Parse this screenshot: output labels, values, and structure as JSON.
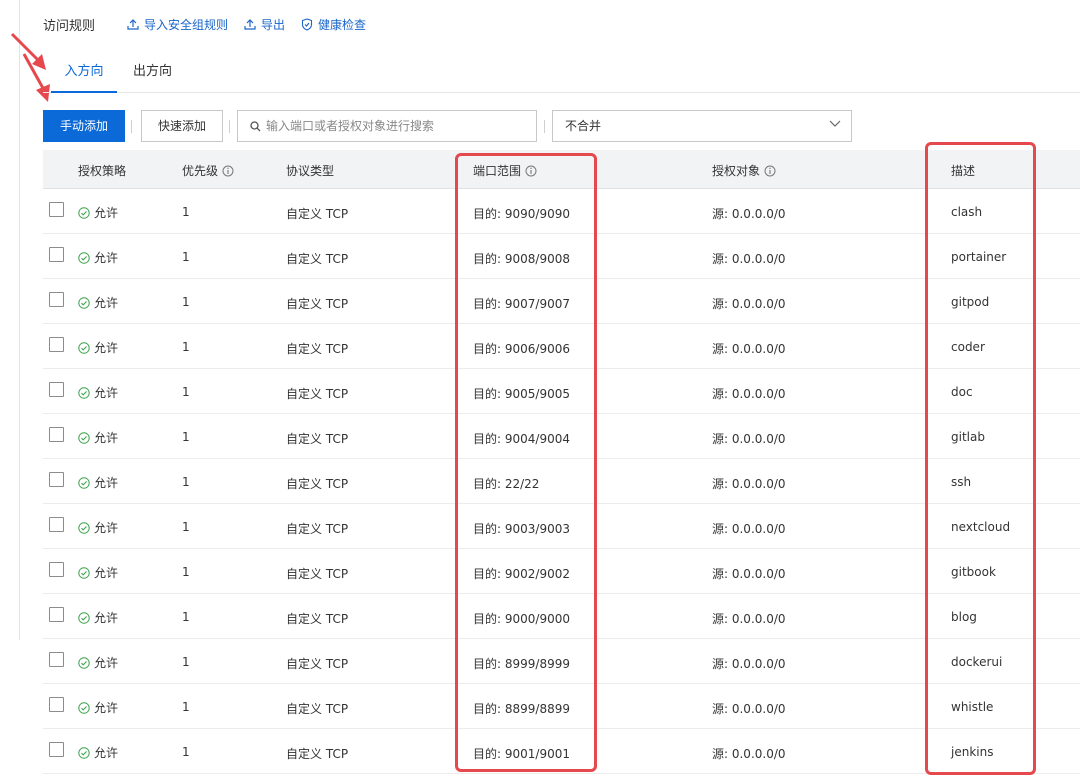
{
  "header": {
    "title": "访问规则",
    "import_label": "导入安全组规则",
    "export_label": "导出",
    "health_label": "健康检查"
  },
  "tabs": {
    "inbound": "入方向",
    "outbound": "出方向"
  },
  "toolbar": {
    "manual_add": "手动添加",
    "quick_add": "快速添加",
    "search_placeholder": "输入端口或者授权对象进行搜索",
    "merge_select": "不合并"
  },
  "table": {
    "headers": {
      "policy": "授权策略",
      "priority": "优先级",
      "protocol": "协议类型",
      "port_range": "端口范围",
      "auth_object": "授权对象",
      "description": "描述"
    },
    "rows": [
      {
        "policy": "允许",
        "priority": "1",
        "protocol": "自定义 TCP",
        "port": "目的: 9090/9090",
        "object": "源: 0.0.0.0/0",
        "desc": "clash"
      },
      {
        "policy": "允许",
        "priority": "1",
        "protocol": "自定义 TCP",
        "port": "目的: 9008/9008",
        "object": "源: 0.0.0.0/0",
        "desc": "portainer"
      },
      {
        "policy": "允许",
        "priority": "1",
        "protocol": "自定义 TCP",
        "port": "目的: 9007/9007",
        "object": "源: 0.0.0.0/0",
        "desc": "gitpod"
      },
      {
        "policy": "允许",
        "priority": "1",
        "protocol": "自定义 TCP",
        "port": "目的: 9006/9006",
        "object": "源: 0.0.0.0/0",
        "desc": "coder"
      },
      {
        "policy": "允许",
        "priority": "1",
        "protocol": "自定义 TCP",
        "port": "目的: 9005/9005",
        "object": "源: 0.0.0.0/0",
        "desc": "doc"
      },
      {
        "policy": "允许",
        "priority": "1",
        "protocol": "自定义 TCP",
        "port": "目的: 9004/9004",
        "object": "源: 0.0.0.0/0",
        "desc": "gitlab"
      },
      {
        "policy": "允许",
        "priority": "1",
        "protocol": "自定义 TCP",
        "port": "目的: 22/22",
        "object": "源: 0.0.0.0/0",
        "desc": "ssh"
      },
      {
        "policy": "允许",
        "priority": "1",
        "protocol": "自定义 TCP",
        "port": "目的: 9003/9003",
        "object": "源: 0.0.0.0/0",
        "desc": "nextcloud"
      },
      {
        "policy": "允许",
        "priority": "1",
        "protocol": "自定义 TCP",
        "port": "目的: 9002/9002",
        "object": "源: 0.0.0.0/0",
        "desc": "gitbook"
      },
      {
        "policy": "允许",
        "priority": "1",
        "protocol": "自定义 TCP",
        "port": "目的: 9000/9000",
        "object": "源: 0.0.0.0/0",
        "desc": "blog"
      },
      {
        "policy": "允许",
        "priority": "1",
        "protocol": "自定义 TCP",
        "port": "目的: 8999/8999",
        "object": "源: 0.0.0.0/0",
        "desc": "dockerui"
      },
      {
        "policy": "允许",
        "priority": "1",
        "protocol": "自定义 TCP",
        "port": "目的: 8899/8899",
        "object": "源: 0.0.0.0/0",
        "desc": "whistle"
      },
      {
        "policy": "允许",
        "priority": "1",
        "protocol": "自定义 TCP",
        "port": "目的: 9001/9001",
        "object": "源: 0.0.0.0/0",
        "desc": "jenkins"
      }
    ]
  },
  "icons": {
    "import": "upload-icon",
    "export": "export-icon",
    "health": "shield-check-icon",
    "search": "search-icon",
    "select": "chevron-down-icon",
    "info": "info-icon",
    "allow": "check-circle-icon"
  },
  "colors": {
    "primary": "#0b6ad8",
    "link": "#1a66c9",
    "allow_green": "#3fa34d",
    "highlight_red": "#e5484d",
    "header_bg": "#f2f3f5"
  }
}
